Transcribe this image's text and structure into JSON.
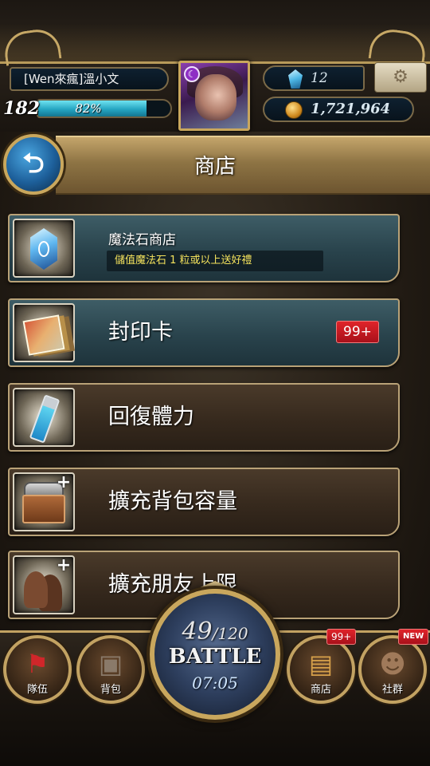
{
  "player": {
    "name": "[Wen來瘋]溫小文",
    "level": "182",
    "exp_percent_text": "82%",
    "exp_fraction": 0.82,
    "gems": "12",
    "coins": "1,721,964"
  },
  "page": {
    "title": "商店"
  },
  "shop": {
    "items": [
      {
        "label": "魔法石商店",
        "subtitle": "儲值魔法石 1 粒或以上送好禮",
        "icon": "magic-stone-icon"
      },
      {
        "label": "封印卡",
        "badge": "99+",
        "icon": "seal-cards-icon"
      },
      {
        "label": "回復體力",
        "icon": "stamina-potion-icon"
      },
      {
        "label": "擴充背包容量",
        "icon": "backpack-chest-icon"
      },
      {
        "label": "擴充朋友上限",
        "icon": "friends-icon"
      }
    ]
  },
  "nav": {
    "team": {
      "label": "隊伍",
      "icon": "flag-icon"
    },
    "bag": {
      "label": "背包",
      "icon": "bag-icon"
    },
    "shop": {
      "label": "商店",
      "badge": "99+",
      "icon": "treasure-chest-icon"
    },
    "social": {
      "label": "社群",
      "badge": "NEW",
      "icon": "social-icon"
    }
  },
  "battle": {
    "energy_current": "49",
    "energy_max": "/120",
    "label": "BATTLE",
    "timer": "07:05"
  },
  "colors": {
    "gold_border": "#c9a75d",
    "teal_panel": "#2c4750",
    "brown_panel": "#36291d",
    "badge_red": "#c8161e",
    "exp_fill": "#25a5c2",
    "subtitle_text": "#f4e25c"
  }
}
